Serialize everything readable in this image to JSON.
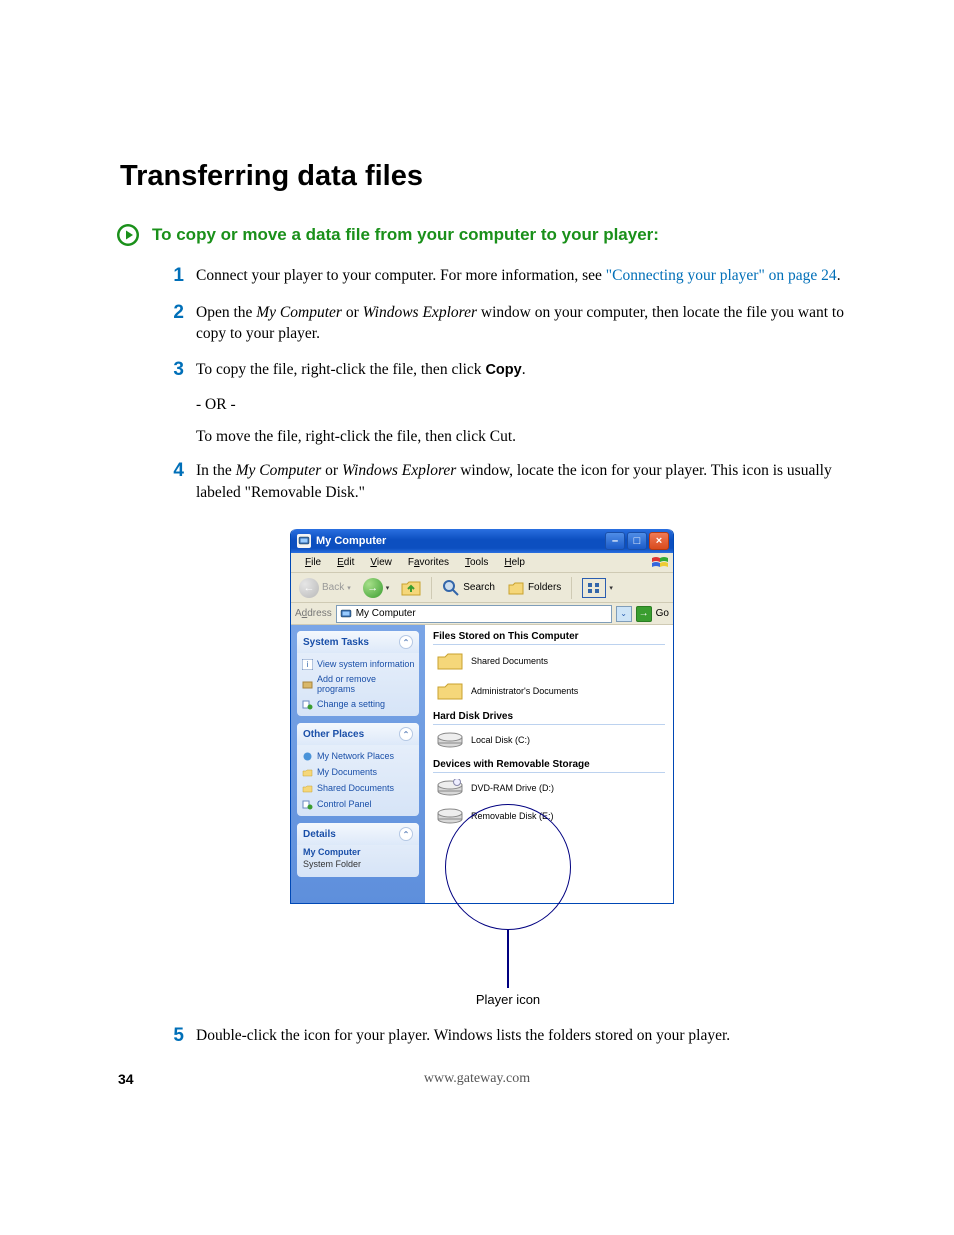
{
  "title": "Transferring data files",
  "subtitle": "To copy or move a data file from your computer to your player:",
  "steps": {
    "s1_a": "Connect your player to your computer. For more information, see ",
    "s1_link": "\"Connecting your player\" on page 24",
    "s1_b": ".",
    "s2_a": "Open the ",
    "s2_em1": "My Computer",
    "s2_b": " or ",
    "s2_em2": "Windows Explorer",
    "s2_c": " window on your computer, then locate the file you want to copy to your player.",
    "s3_a": "To copy the file, right-click the file, then click ",
    "s3_bold": "Copy",
    "s3_b": ".",
    "or_text": "- OR -",
    "s3_alt_a": "To move the file, right-click the file, then click ",
    "s3_alt_bold": "Cut",
    "s3_alt_b": ".",
    "s4_a": "In the ",
    "s4_em1": "My Computer",
    "s4_b": " or ",
    "s4_em2": "Windows Explorer",
    "s4_c": " window, locate the icon for your player. This icon is usually labeled \"Removable Disk.\"",
    "s5": "Double-click the icon for your player. Windows lists the folders stored on your player."
  },
  "numbers": {
    "n1": "1",
    "n2": "2",
    "n3": "3",
    "n4": "4",
    "n5": "5"
  },
  "window": {
    "title": "My Computer",
    "menu": {
      "file": "File",
      "edit": "Edit",
      "view": "View",
      "favorites": "Favorites",
      "tools": "Tools",
      "help": "Help"
    },
    "toolbar": {
      "back": "Back",
      "search": "Search",
      "folders": "Folders"
    },
    "address_label": "Address",
    "address_value": "My Computer",
    "go_label": "Go",
    "sidebar": {
      "system_tasks": {
        "title": "System Tasks",
        "items": [
          "View system information",
          "Add or remove programs",
          "Change a setting"
        ]
      },
      "other_places": {
        "title": "Other Places",
        "items": [
          "My Network Places",
          "My Documents",
          "Shared Documents",
          "Control Panel"
        ]
      },
      "details": {
        "title": "Details",
        "name": "My Computer",
        "type": "System Folder"
      }
    },
    "content": {
      "groups": {
        "stored": {
          "title": "Files Stored on This Computer",
          "items": [
            "Shared Documents",
            "Administrator's Documents"
          ]
        },
        "hdd": {
          "title": "Hard Disk Drives",
          "items": [
            "Local Disk (C:)"
          ]
        },
        "removable": {
          "title": "Devices with Removable Storage",
          "items": [
            "DVD-RAM Drive (D:)",
            "Removable Disk (E:)"
          ]
        }
      }
    }
  },
  "callout_label": "Player icon",
  "page_number": "34",
  "footer_url": "www.gateway.com"
}
